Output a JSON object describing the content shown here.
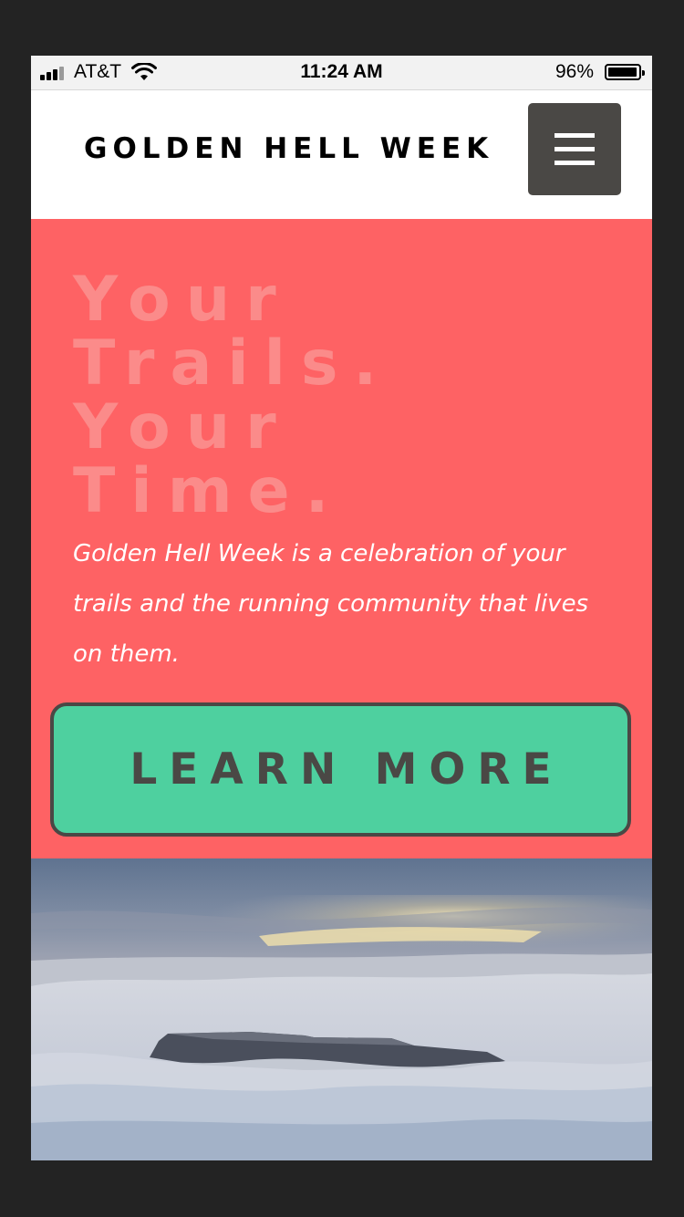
{
  "status_bar": {
    "carrier": "AT&T",
    "time": "11:24 AM",
    "battery_percent": "96%",
    "battery_level": 0.96
  },
  "header": {
    "site_title": "GOLDEN HELL WEEK",
    "menu_icon": "hamburger-menu-icon"
  },
  "hero": {
    "headline": "Your\nTrails.\nYour\nTime.",
    "description": "Golden Hell Week is a celebration of your trails and the running community that lives on them.",
    "cta_label": "LEARN MORE"
  },
  "photo": {
    "subject": "mesa-above-sea-of-clouds"
  },
  "colors": {
    "page_background": "#232323",
    "hero_background": "#fe6264",
    "headline_color": "#fb8b8a",
    "cta_background": "#4ed09f",
    "dark_accent": "#4a4845"
  }
}
